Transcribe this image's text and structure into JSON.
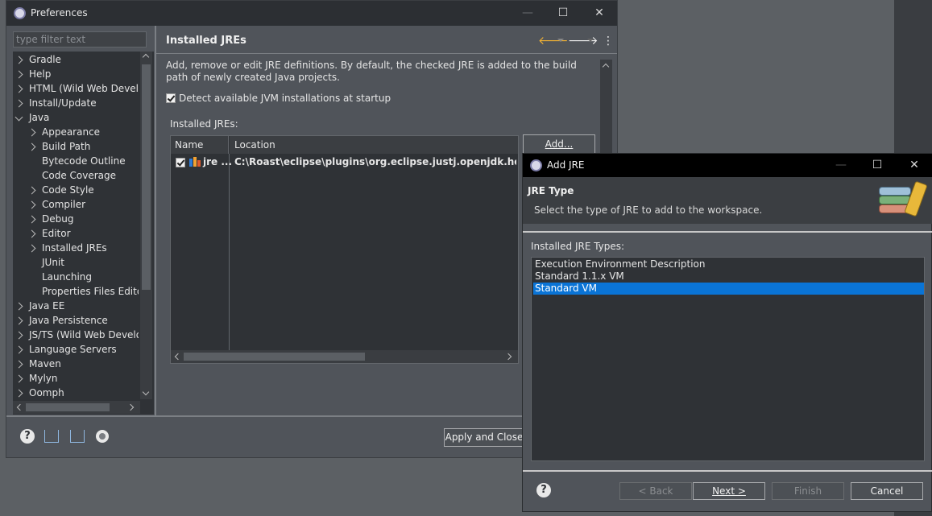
{
  "preferences": {
    "title": "Preferences",
    "filter_placeholder": "type filter text",
    "tree": [
      {
        "label": "Gradle",
        "expandable": true
      },
      {
        "label": "Help",
        "expandable": true
      },
      {
        "label": "HTML (Wild Web Develo",
        "expandable": true
      },
      {
        "label": "Install/Update",
        "expandable": true
      },
      {
        "label": "Java",
        "expandable": true,
        "expanded": true
      },
      {
        "label": "Appearance",
        "expandable": true,
        "child": true
      },
      {
        "label": "Build Path",
        "expandable": true,
        "child": true
      },
      {
        "label": "Bytecode Outline",
        "child": true
      },
      {
        "label": "Code Coverage",
        "child": true
      },
      {
        "label": "Code Style",
        "expandable": true,
        "child": true
      },
      {
        "label": "Compiler",
        "expandable": true,
        "child": true
      },
      {
        "label": "Debug",
        "expandable": true,
        "child": true
      },
      {
        "label": "Editor",
        "expandable": true,
        "child": true
      },
      {
        "label": "Installed JREs",
        "expandable": true,
        "child": true
      },
      {
        "label": "JUnit",
        "child": true
      },
      {
        "label": "Launching",
        "child": true
      },
      {
        "label": "Properties Files Edito",
        "child": true
      },
      {
        "label": "Java EE",
        "expandable": true
      },
      {
        "label": "Java Persistence",
        "expandable": true
      },
      {
        "label": "JS/TS (Wild Web Develo",
        "expandable": true
      },
      {
        "label": "Language Servers",
        "expandable": true
      },
      {
        "label": "Maven",
        "expandable": true
      },
      {
        "label": "Mylyn",
        "expandable": true
      },
      {
        "label": "Oomph",
        "expandable": true
      }
    ],
    "page_title": "Installed JREs",
    "description": "Add, remove or edit JRE definitions. By default, the checked JRE is added to the build path of newly created Java projects.",
    "detect_label": "Detect available JVM installations at startup",
    "installed_label": "Installed JREs:",
    "columns": [
      "Name",
      "Location"
    ],
    "row": {
      "name": "jre ...",
      "location": "C:\\Roast\\eclipse\\plugins\\org.eclipse.justj.openjdk.hotspot."
    },
    "add_button": "Add...",
    "apply_close": "Apply and Close"
  },
  "dialog": {
    "title": "Add JRE",
    "header_title": "JRE Type",
    "header_desc": "Select the type of JRE to add to the workspace.",
    "list_label": "Installed JRE Types:",
    "types": [
      "Execution Environment Description",
      "Standard 1.1.x VM",
      "Standard VM"
    ],
    "selected_index": 2,
    "buttons": {
      "back": "< Back",
      "next": "Next >",
      "finish": "Finish",
      "cancel": "Cancel"
    }
  },
  "colors": {
    "selection": "#0a74d6",
    "background": "#50545a"
  }
}
